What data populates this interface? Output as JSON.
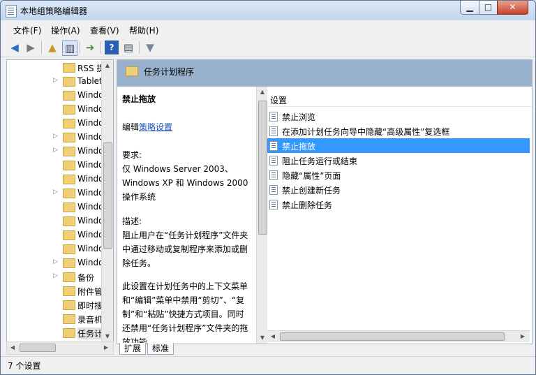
{
  "window": {
    "title": "本地组策略编辑器"
  },
  "menu": [
    "文件(F)",
    "操作(A)",
    "查看(V)",
    "帮助(H)"
  ],
  "toolbar": {
    "icons": [
      "back-arrow",
      "forward-arrow",
      "up-folder",
      "show-hide-tree",
      "export-list",
      "help",
      "properties",
      "filter"
    ]
  },
  "tree": {
    "items": [
      {
        "label": "RSS 提",
        "expandable": false
      },
      {
        "label": "Tablet",
        "expandable": true
      },
      {
        "label": "Windo",
        "expandable": false
      },
      {
        "label": "Windo",
        "expandable": false
      },
      {
        "label": "Windo",
        "expandable": false
      },
      {
        "label": "Windo",
        "expandable": true
      },
      {
        "label": "Windo",
        "expandable": true
      },
      {
        "label": "Windo",
        "expandable": false
      },
      {
        "label": "Windo",
        "expandable": false
      },
      {
        "label": "Windo",
        "expandable": true
      },
      {
        "label": "Windo",
        "expandable": false
      },
      {
        "label": "Windo",
        "expandable": false
      },
      {
        "label": "Windo",
        "expandable": false
      },
      {
        "label": "Windo",
        "expandable": false
      },
      {
        "label": "Windo",
        "expandable": true
      },
      {
        "label": "备份",
        "expandable": true
      },
      {
        "label": "附件管",
        "expandable": false
      },
      {
        "label": "即时搜",
        "expandable": false
      },
      {
        "label": "录音机",
        "expandable": false
      },
      {
        "label": "任务计",
        "expandable": false,
        "selected": true
      }
    ]
  },
  "banner": {
    "title": "任务计划程序"
  },
  "description": {
    "heading": "禁止拖放",
    "edit_prefix": "编辑",
    "edit_link": "策略设置",
    "req_label": "要求:",
    "req_text": "仅 Windows Server 2003、Windows XP 和 Windows 2000 操作系统",
    "desc_label": "描述:",
    "desc_text1": "阻止用户在“任务计划程序”文件夹中通过移动或复制程序来添加或删除任务。",
    "desc_text2": "此设置在计划任务中的上下文菜单和“编辑”菜单中禁用“剪切”、“复制”和“粘贴”快捷方式项目。同时还禁用“任务计划程序”文件夹的拖放功能。"
  },
  "settings": {
    "header": "设置",
    "items": [
      {
        "label": "禁止浏览"
      },
      {
        "label": "在添加计划任务向导中隐藏“高级属性”复选框"
      },
      {
        "label": "禁止拖放",
        "selected": true
      },
      {
        "label": "阻止任务运行或结束"
      },
      {
        "label": "隐藏“属性”页面"
      },
      {
        "label": "禁止创建新任务"
      },
      {
        "label": "禁止删除任务"
      }
    ]
  },
  "tabs": [
    "扩展",
    "标准"
  ],
  "status": "7 个设置",
  "colors": {
    "selection": "#3399ff",
    "banner": "#97b1cc",
    "link": "#1f52b8"
  }
}
